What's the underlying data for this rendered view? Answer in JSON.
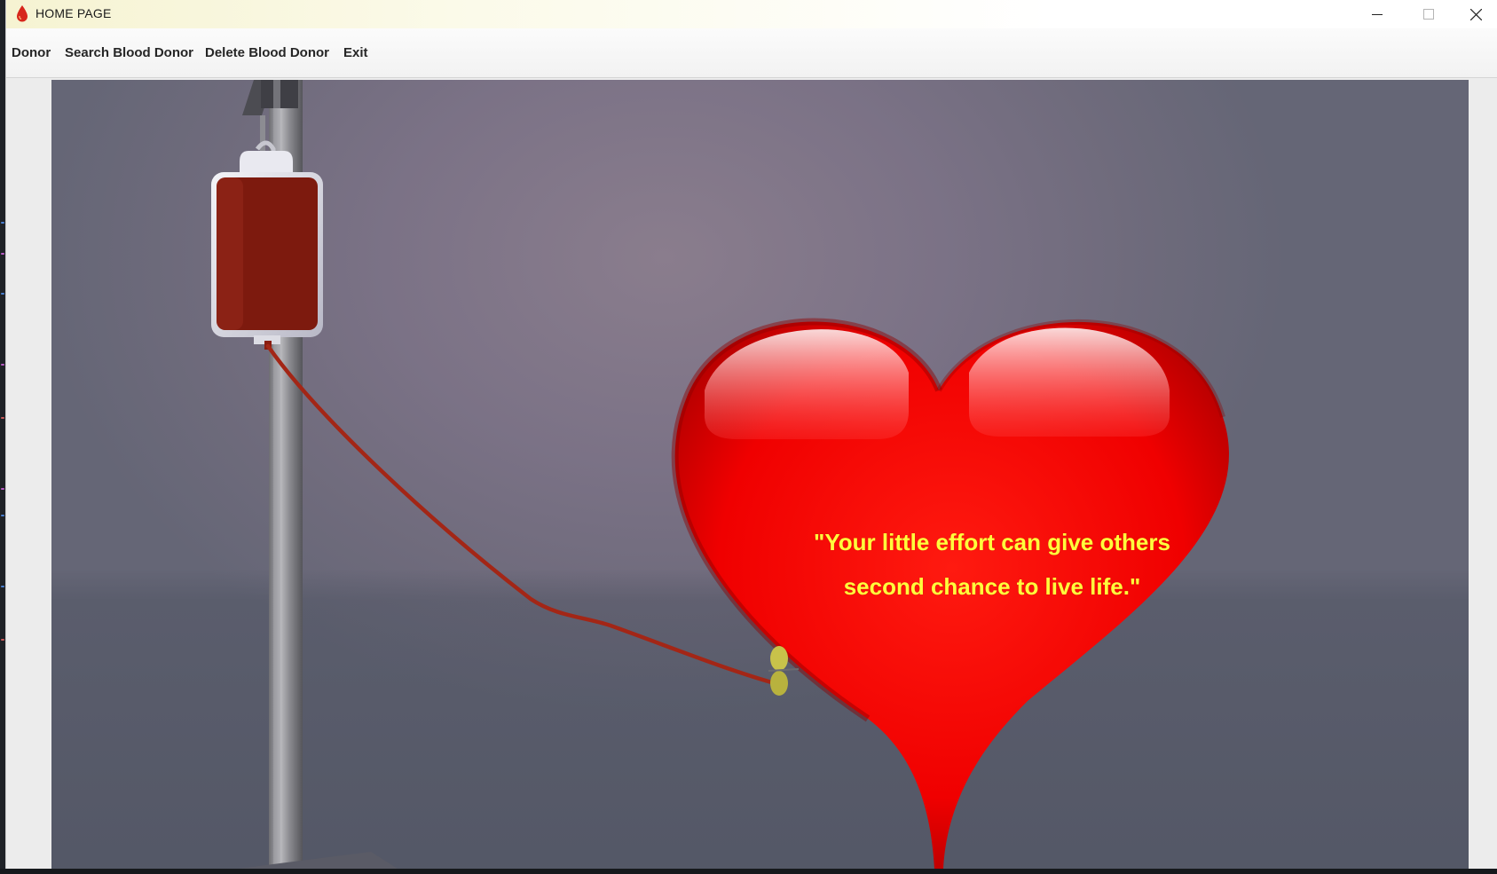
{
  "window": {
    "title": "HOME PAGE",
    "icon": "blood-drop-icon",
    "controls": [
      "minimize-icon",
      "maximize-icon",
      "close-icon"
    ]
  },
  "menubar": {
    "items": [
      {
        "label": "Donor"
      },
      {
        "label": "Search Blood Donor"
      },
      {
        "label": "Delete Blood Donor"
      },
      {
        "label": "Exit"
      }
    ]
  },
  "banner": {
    "quote_line1": "\"Your little effort can give others",
    "quote_line2": "second chance to live life.\"",
    "quote_color": "#ffff3c",
    "heart_color": "#ff0000",
    "blood_bag_color": "#7d1a0e"
  }
}
